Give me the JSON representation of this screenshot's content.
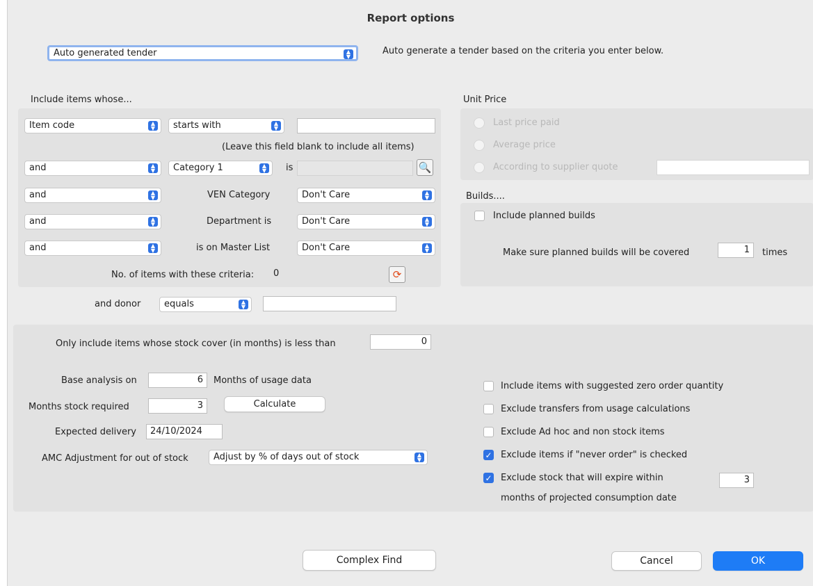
{
  "window": {
    "title": "Report options"
  },
  "report_type": {
    "value": "Auto generated tender",
    "description": "Auto generate a tender based on the criteria you enter below."
  },
  "filter": {
    "heading": "Include items whose...",
    "row1": {
      "field": "Item code",
      "operator": "starts with",
      "value": ""
    },
    "hint": "(Leave this field blank to include all items)",
    "row2": {
      "conj": "and",
      "field": "Category 1",
      "is_label": "is",
      "value": ""
    },
    "row3": {
      "conj": "and",
      "label": "VEN Category",
      "value": "Don't Care"
    },
    "row4": {
      "conj": "and",
      "label": "Department is",
      "value": "Don't Care"
    },
    "row5": {
      "conj": "and",
      "label": "is on Master List",
      "value": "Don't Care"
    },
    "count_label": "No. of items with these criteria:",
    "count_value": "0"
  },
  "donor": {
    "label": "and donor",
    "operator": "equals",
    "value": ""
  },
  "unit_price": {
    "heading": "Unit Price",
    "options": [
      "Last price paid",
      "Average price",
      "According to supplier quote"
    ],
    "supplier_quote_value": ""
  },
  "builds": {
    "heading": "Builds....",
    "include_label": "Include planned builds",
    "cover_label": "Make sure planned builds will be covered",
    "cover_value": "1",
    "times_label": "times"
  },
  "analysis": {
    "stock_cover_label": "Only include items whose stock cover (in months) is less than",
    "stock_cover_value": "0",
    "base_label": "Base analysis on",
    "base_value": "6",
    "base_suffix": "Months of usage data",
    "months_required_label": "Months stock required",
    "months_required_value": "3",
    "calculate_label": "Calculate",
    "delivery_label": "Expected delivery",
    "delivery_value": "24/10/2024",
    "amc_label": "AMC Adjustment for out of stock",
    "amc_value": "Adjust by % of days out of stock"
  },
  "options": {
    "zero_qty": {
      "label": "Include items with suggested zero order quantity",
      "checked": false
    },
    "transfers": {
      "label": "Exclude transfers from usage calculations",
      "checked": false
    },
    "adhoc": {
      "label": "Exclude Ad hoc and non stock items",
      "checked": false
    },
    "never_order": {
      "label": "Exclude items if \"never order\" is checked",
      "checked": true
    },
    "expire": {
      "label": "Exclude stock that will expire within",
      "label2": "months of projected consumption date",
      "value": "3",
      "checked": true
    }
  },
  "footer": {
    "complex_find": "Complex Find",
    "cancel": "Cancel",
    "ok": "OK"
  },
  "colors": {
    "accent": "#1e7cf6",
    "panel": "#e2e2e2",
    "window": "#ececec"
  }
}
